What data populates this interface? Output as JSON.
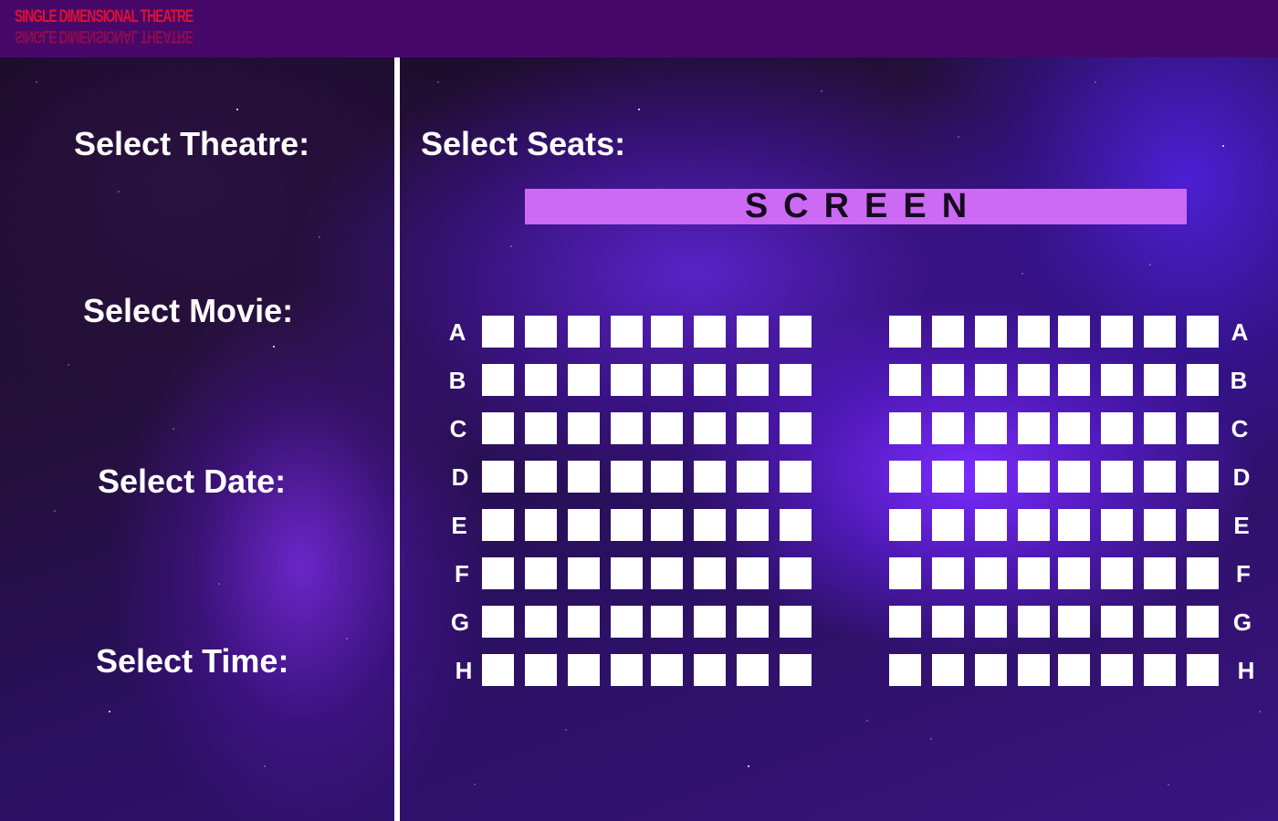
{
  "header": {
    "logo_text": "SINGLE DIMENSIONAL THEATRE",
    "background": "#48086a",
    "logo_color": "#e01030"
  },
  "left_panel": {
    "theatre_label": "Select Theatre:",
    "movie_label": "Select Movie:",
    "date_label": "Select Date:",
    "time_label": "Select Time:"
  },
  "seating": {
    "title": "Select Seats:",
    "screen_label": "SCREEN",
    "screen_color": "#cc6af4",
    "rows": [
      "A",
      "B",
      "C",
      "D",
      "E",
      "F",
      "G",
      "H"
    ],
    "seats_per_section": 8,
    "sections": [
      "left",
      "right"
    ],
    "seat_color": "#ffffff"
  }
}
